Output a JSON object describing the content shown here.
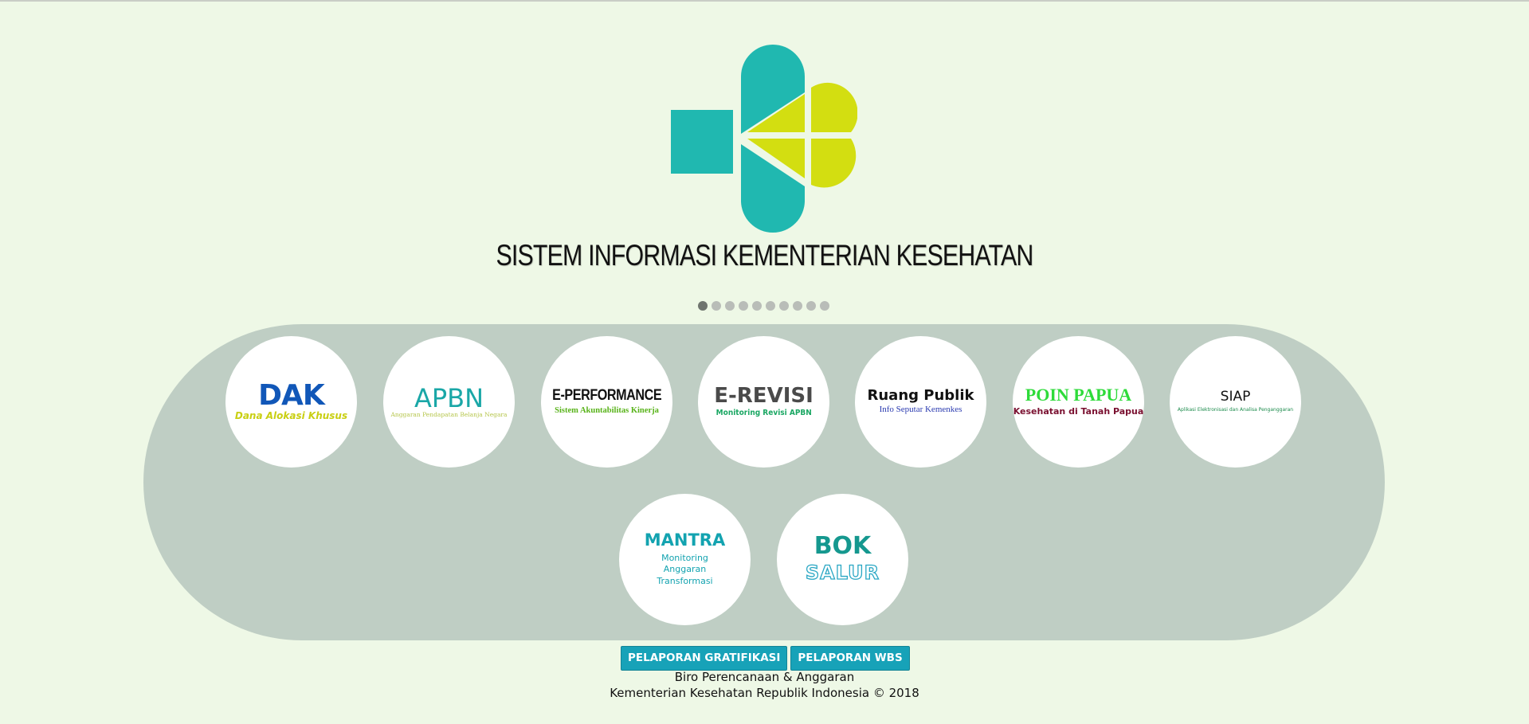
{
  "header": {
    "title": "SISTEM INFORMASI KEMENTERIAN KESEHATAN"
  },
  "carousel": {
    "slide_count": 10,
    "active_index": 0
  },
  "apps": [
    {
      "id": "dak",
      "title": "DAK",
      "subtitle": "Dana Alokasi Khusus"
    },
    {
      "id": "apbn",
      "title": "APBN",
      "subtitle": "Anggaran Pendapatan Belanja Negara"
    },
    {
      "id": "eperf",
      "title": "E-PERFORMANCE",
      "subtitle": "Sistem Akuntabilitas Kinerja"
    },
    {
      "id": "erev",
      "title": "E-REVISI",
      "subtitle": "Monitoring Revisi APBN"
    },
    {
      "id": "ruang",
      "title": "Ruang Publik",
      "subtitle": "Info Seputar Kemenkes"
    },
    {
      "id": "poin",
      "title": "POIN PAPUA",
      "subtitle": "Kesehatan di Tanah Papua"
    },
    {
      "id": "siap",
      "title": "SIAP",
      "subtitle": "Aplikasi Elektronisasi dan Analisa Penganggaran"
    },
    {
      "id": "mantra",
      "title": "MANTRA",
      "subtitle": "Monitoring Anggaran Transformasi"
    },
    {
      "id": "bok",
      "title": "BOK",
      "subtitle": "SALUR"
    }
  ],
  "footer": {
    "buttons": [
      "PELAPORAN GRATIFIKASI",
      "PELAPORAN WBS"
    ],
    "line1": "Biro Perencanaan & Anggaran",
    "line2": "Kementerian Kesehatan Republik Indonesia © 2018"
  },
  "colors": {
    "background": "#eef8e6",
    "panel": "#bfcec4",
    "logo_teal": "#20b8b0",
    "logo_lime": "#d3de11",
    "button": "#17a2b8"
  }
}
